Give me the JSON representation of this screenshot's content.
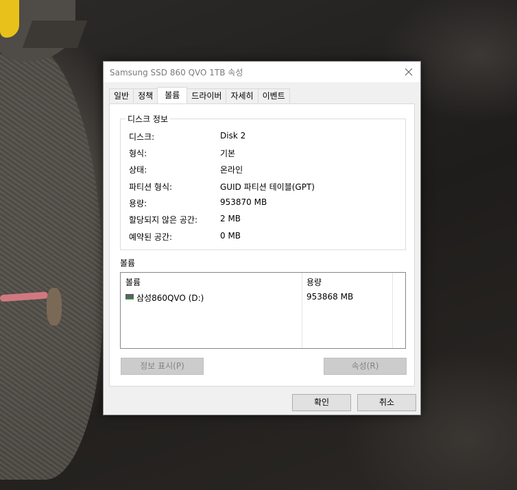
{
  "window": {
    "title": "Samsung SSD 860 QVO 1TB 속성"
  },
  "tabs": [
    {
      "label": "일반",
      "active": false
    },
    {
      "label": "정책",
      "active": false
    },
    {
      "label": "볼륨",
      "active": true
    },
    {
      "label": "드라이버",
      "active": false
    },
    {
      "label": "자세히",
      "active": false
    },
    {
      "label": "이벤트",
      "active": false
    }
  ],
  "disk_info": {
    "legend": "디스크 정보",
    "rows": [
      {
        "label": "디스크:",
        "value": "Disk 2"
      },
      {
        "label": "형식:",
        "value": "기본"
      },
      {
        "label": "상태:",
        "value": "온라인"
      },
      {
        "label": "파티션 형식:",
        "value": "GUID 파티션 테이블(GPT)"
      },
      {
        "label": "용량:",
        "value": "953870 MB"
      },
      {
        "label": "할당되지 않은 공간:",
        "value": "2 MB"
      },
      {
        "label": "예약된 공간:",
        "value": "0 MB"
      }
    ]
  },
  "volumes": {
    "label": "볼륨",
    "columns": [
      "볼륨",
      "용량"
    ],
    "rows": [
      {
        "name": "삼성860QVO (D:)",
        "capacity": "953868 MB",
        "icon": "drive-icon"
      }
    ]
  },
  "buttons": {
    "populate": "정보 표시(P)",
    "properties": "속성(R)",
    "ok": "확인",
    "cancel": "취소"
  },
  "colors": {
    "title_text": "#7a7a7a",
    "disabled_button_bg": "#cccccc",
    "disabled_button_text": "#838383",
    "button_bg": "#e1e1e1"
  }
}
